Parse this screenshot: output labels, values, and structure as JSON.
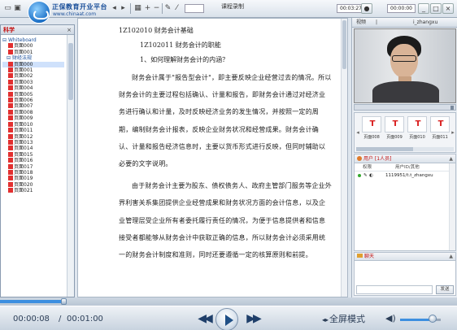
{
  "window": {
    "title": "课程录制",
    "page_value": "",
    "clock_left": "00:03:27",
    "clock_right": "00:00:00"
  },
  "logo": {
    "title": "正保教育开业平台",
    "url": "www.chinaat.com"
  },
  "toolbar": {
    "icons": [
      "folder-icon",
      "save-icon",
      "undo-icon",
      "redo-icon",
      "grid-icon",
      "zoom-out-icon",
      "zoom-in-icon",
      "first-page-icon",
      "prev-page-icon",
      "play-icon",
      "pencil-icon",
      "marker-icon",
      "eraser-icon",
      "cursor-icon",
      "shape-icon",
      "text-icon",
      "color-icon"
    ]
  },
  "left_panel": {
    "title": "科学",
    "close": "×",
    "tree": [
      {
        "type": "root",
        "label": "Whiteboard"
      },
      {
        "type": "leaf",
        "label": "页面000"
      },
      {
        "type": "leaf",
        "label": "页面001"
      },
      {
        "type": "sub",
        "label": "财经法规"
      },
      {
        "type": "leaf",
        "label": "页面000"
      },
      {
        "type": "leaf",
        "label": "页面001"
      },
      {
        "type": "leaf",
        "label": "页面002"
      },
      {
        "type": "leaf",
        "label": "页面003"
      },
      {
        "type": "leaf",
        "label": "页面004"
      },
      {
        "type": "leaf",
        "label": "页面005"
      },
      {
        "type": "leaf",
        "label": "页面006"
      },
      {
        "type": "leaf",
        "label": "页面007"
      },
      {
        "type": "leaf",
        "label": "页面008"
      },
      {
        "type": "leaf",
        "label": "页面009"
      },
      {
        "type": "leaf",
        "label": "页面010"
      },
      {
        "type": "leaf",
        "label": "页面011"
      },
      {
        "type": "leaf",
        "label": "页面012"
      },
      {
        "type": "leaf",
        "label": "页面013"
      },
      {
        "type": "leaf",
        "label": "页面014"
      },
      {
        "type": "leaf",
        "label": "页面015"
      },
      {
        "type": "leaf",
        "label": "页面016"
      },
      {
        "type": "leaf",
        "label": "页面017"
      },
      {
        "type": "leaf",
        "label": "页面018"
      },
      {
        "type": "leaf",
        "label": "页面019"
      },
      {
        "type": "leaf",
        "label": "页面020"
      },
      {
        "type": "leaf",
        "label": "页面021"
      }
    ]
  },
  "document": {
    "h1": "1Z102010  财务会计基础",
    "h2": "1Z102011  财务会计的职能",
    "h3": "1、如何理解财务会计的内涵？",
    "p1": "财务会计属于\"报告型会计\"，即主要反映企业经营过去的情况。所以财务会计的主要过程包括确认、计量和报告，即财务会计通过对经济业务进行确认和计量，及时反映经济业务的发生情况，并按照一定的周期，编制财务会计报表，反映企业财务状况和经营成果。财务会计确认、计量和报告经济信息时，主要以货币形式进行反映，但同时辅助以必要的文字说明。",
    "p2": "由于财务会计主要为股东、债权债务人、政府主管部门服务等企业外界利害关系集团提供企业经营成果和财务状况方面的会计信息，以及企业管理层受企业所有者委托履行责任的情况，为便于信息提供者和信息接受者都能够从财务会计中获取正确的信息，所以财务会计必须采用统一的财务会计制度和准则，同时还要遵循一定的核算原则和前提。"
  },
  "right_panel": {
    "tabs": [
      "视频",
      "|",
      "i_zhangxu"
    ],
    "slide_captions": [
      "页面008",
      "页面009",
      "页面010",
      "页面011"
    ],
    "users_title": "用户 [1人员]",
    "users_collapse": "▲",
    "users_cols": [
      "权限",
      "用户ID/其他"
    ],
    "users": [
      {
        "id": "1119951/t.t_zhangxu"
      }
    ],
    "chat_title": "聊天",
    "chat_collapse": "▲",
    "chat_send": "发送"
  },
  "player": {
    "current_time": "00:00:08",
    "separator": "/",
    "total_time": "00:01:00",
    "progress": 0.14,
    "fullscreen_label": "全屏模式",
    "volume": 0.8
  }
}
